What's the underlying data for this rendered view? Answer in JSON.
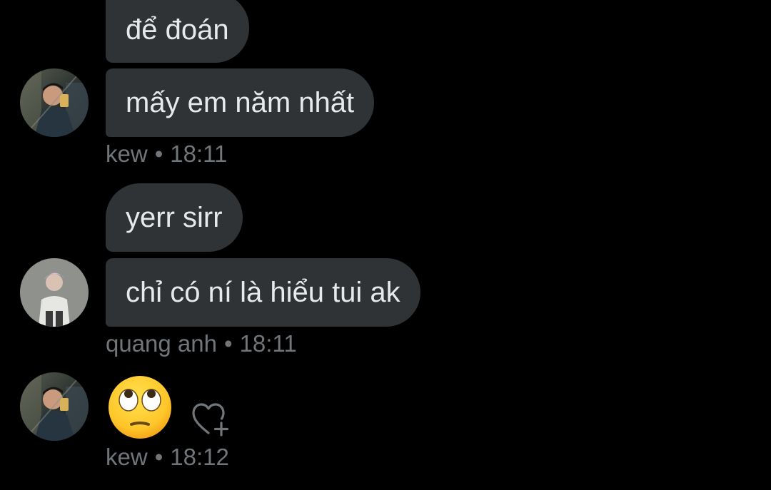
{
  "messages": [
    {
      "text": "để đoán"
    },
    {
      "text": "mấy em năm nhất"
    },
    {
      "text": "yerr sirr"
    },
    {
      "text": "chỉ có ní là hiểu tui ak"
    }
  ],
  "meta": [
    {
      "sender": "kew",
      "separator": "•",
      "time": "18:11"
    },
    {
      "sender": "quang anh",
      "separator": "•",
      "time": "18:11"
    },
    {
      "sender": "kew",
      "separator": "•",
      "time": "18:12"
    }
  ],
  "emoji_message": {
    "icon": "face-with-rolling-eyes-emoji"
  },
  "reaction_button": {
    "icon": "add-reaction-heart-icon"
  },
  "colors": {
    "background": "#000000",
    "bubble": "#2f3336",
    "text": "#e7e9ea",
    "meta": "#71767b"
  }
}
